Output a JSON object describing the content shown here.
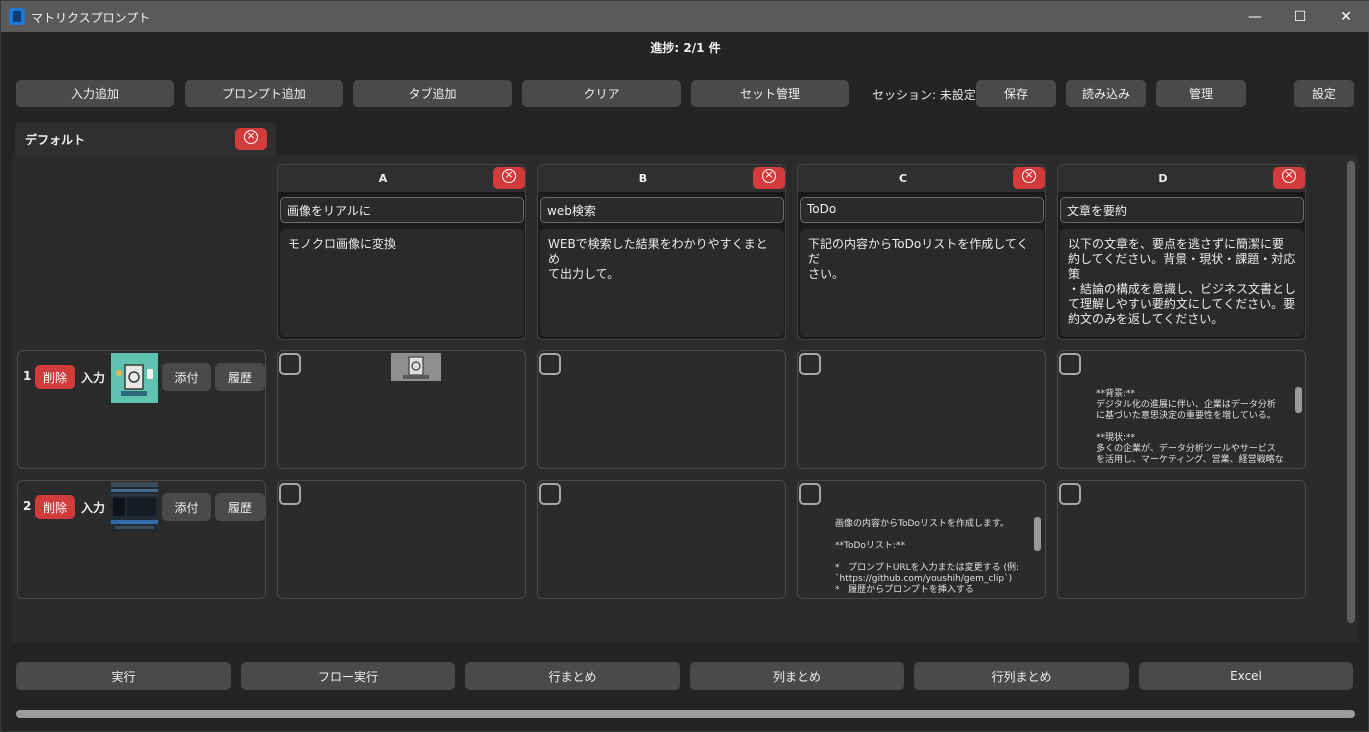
{
  "window": {
    "title": "マトリクスプロンプト",
    "minimize": "—",
    "maximize": "☐",
    "close": "✕"
  },
  "progress": "進捗: 2/1 件",
  "toolbar": {
    "add_input": "入力追加",
    "add_prompt": "プロンプト追加",
    "add_tab": "タブ追加",
    "clear": "クリア",
    "set_manage": "セット管理",
    "session": "セッション: 未設定",
    "save": "保存",
    "load": "読み込み",
    "manage": "管理",
    "settings": "設定"
  },
  "tabs": [
    {
      "label": "デフォルト"
    }
  ],
  "columns": [
    {
      "letter": "A",
      "name": "画像をリアルに",
      "prompt": "モノクロ画像に変換"
    },
    {
      "letter": "B",
      "name": "web検索",
      "prompt": "WEBで検索した結果をわかりやすくまとめ\nて出力して。"
    },
    {
      "letter": "C",
      "name": "ToDo",
      "prompt": "下記の内容からToDoリストを作成してくだ\nさい。"
    },
    {
      "letter": "D",
      "name": "文章を要約",
      "prompt": "以下の文章を、要点を逃さずに簡潔に要\n約してください。背景・現状・課題・対応策\n・結論の構成を意識し、ビジネス文書とし\nて理解しやすい要約文にしてください。要\n約文のみを返してください。"
    }
  ],
  "rows": [
    {
      "num": "1",
      "delete": "削除",
      "input": "入力",
      "attach": "添付",
      "history": "履歴"
    },
    {
      "num": "2",
      "delete": "削除",
      "input": "入力",
      "attach": "添付",
      "history": "履歴"
    }
  ],
  "results": {
    "r1d": "**背景:**\nデジタル化の進展に伴い、企業はデータ分析\nに基づいた意思決定の重要性を増している。\n\n**現状:**\n多くの企業が、データ分析ツールやサービス\nを活用し、マーケティング、営業、経営戦略な",
    "r2c": "画像の内容からToDoリストを作成します。\n\n**ToDoリスト:**\n\n*   プロンプトURLを入力または変更する (例:\n`https://github.com/youshih/gem_clip`)\n*   履歴からプロンプトを挿入する"
  },
  "bottom": {
    "run": "実行",
    "flow_run": "フロー実行",
    "row_summary": "行まとめ",
    "col_summary": "列まとめ",
    "matrix_summary": "行列まとめ",
    "excel": "Excel"
  }
}
